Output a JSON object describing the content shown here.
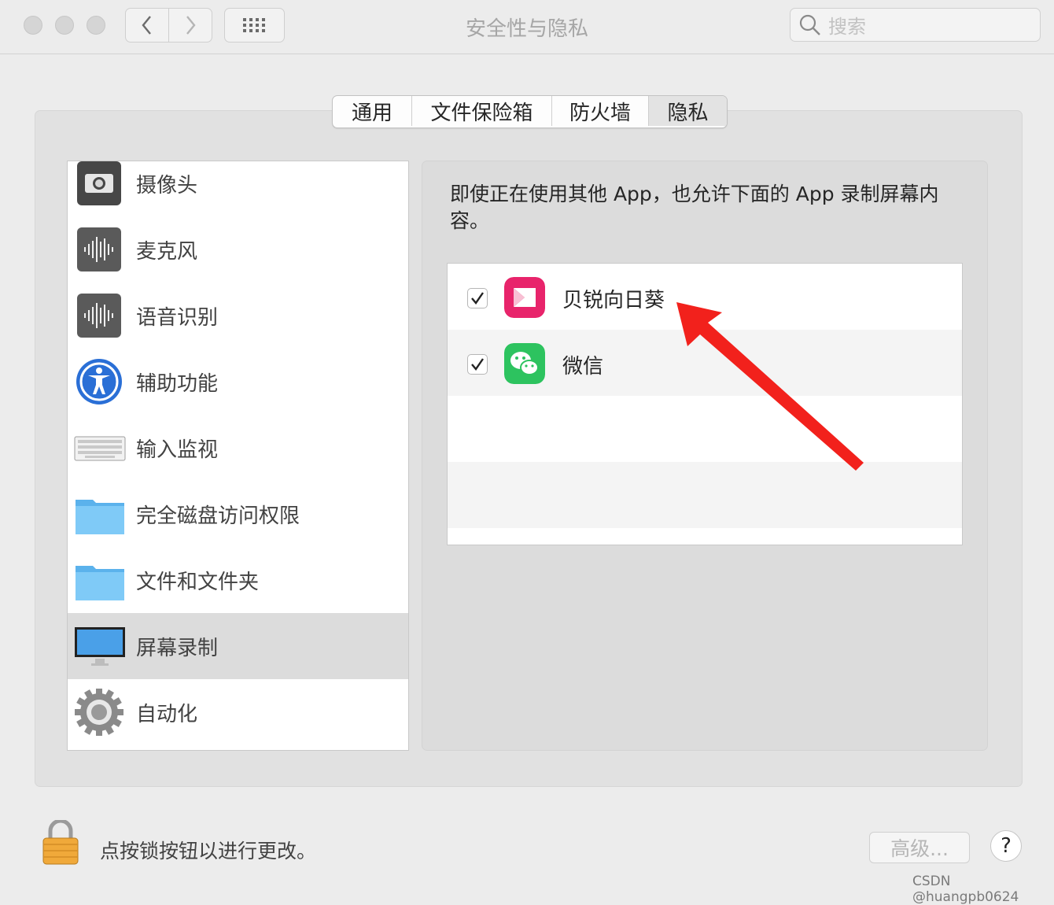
{
  "window": {
    "title": "安全性与隐私"
  },
  "toolbar": {
    "search_placeholder": "搜索"
  },
  "tabs": [
    {
      "label": "通用",
      "active": false
    },
    {
      "label": "文件保险箱",
      "active": false
    },
    {
      "label": "防火墙",
      "active": false
    },
    {
      "label": "隐私",
      "active": true
    }
  ],
  "privacy_list": [
    {
      "label": "摄像头",
      "icon": "camera-icon"
    },
    {
      "label": "麦克风",
      "icon": "microphone-icon"
    },
    {
      "label": "语音识别",
      "icon": "speech-recognition-icon"
    },
    {
      "label": "辅助功能",
      "icon": "accessibility-icon"
    },
    {
      "label": "输入监视",
      "icon": "keyboard-icon"
    },
    {
      "label": "完全磁盘访问权限",
      "icon": "folder-icon"
    },
    {
      "label": "文件和文件夹",
      "icon": "folder-icon"
    },
    {
      "label": "屏幕录制",
      "icon": "display-icon",
      "selected": true
    },
    {
      "label": "自动化",
      "icon": "gear-icon"
    }
  ],
  "detail": {
    "description": "即使正在使用其他 App，也允许下面的 App 录制屏幕内容。",
    "apps": [
      {
        "name": "贝锐向日葵",
        "checked": true,
        "icon": "sunlogin-app-icon",
        "color": "#e8246b"
      },
      {
        "name": "微信",
        "checked": true,
        "icon": "wechat-app-icon",
        "color": "#2dc35f"
      }
    ]
  },
  "footer": {
    "lock_text": "点按锁按钮以进行更改。",
    "advanced_label": "高级...",
    "help_label": "?"
  },
  "watermark": "CSDN @huangpb0624",
  "colors": {
    "annotation_arrow": "#f2211c",
    "selected_row": "#dcdcdc"
  }
}
